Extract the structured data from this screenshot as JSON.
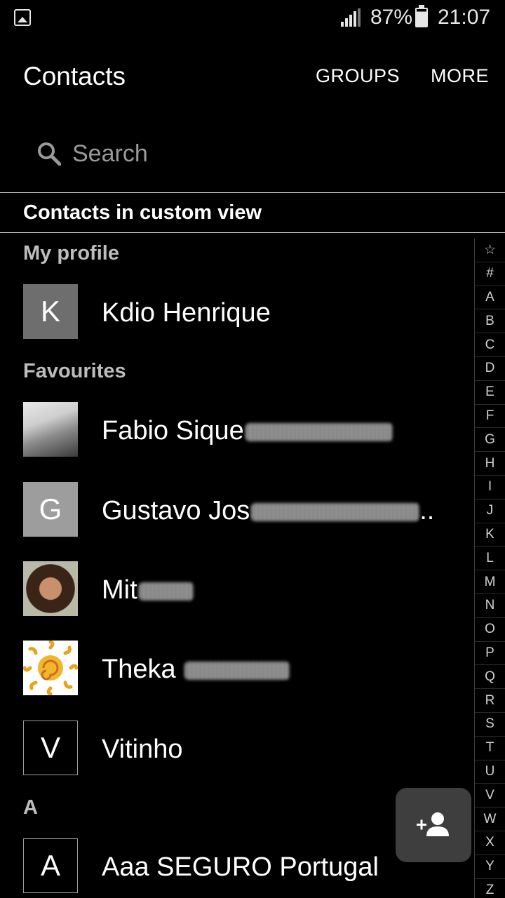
{
  "status_bar": {
    "battery_percent": "87%",
    "time": "21:07",
    "icons": [
      "image-notification-icon",
      "signal-icon",
      "battery-icon"
    ]
  },
  "app_bar": {
    "title": "Contacts",
    "actions": [
      "GROUPS",
      "MORE"
    ]
  },
  "search": {
    "placeholder": "Search"
  },
  "filter_label": "Contacts in custom view",
  "sections": {
    "my_profile": "My profile",
    "favourites": "Favourites",
    "a": "A"
  },
  "contacts": {
    "profile": {
      "initial": "K",
      "name": "Kdio Henrique"
    },
    "fav1": {
      "name": "Fabio Sique"
    },
    "fav2": {
      "initial": "G",
      "name": "Gustavo Jos",
      "ellipsis": ".."
    },
    "fav3": {
      "name": "Mit"
    },
    "fav4": {
      "name": "Theka"
    },
    "fav5": {
      "initial": "V",
      "name": "Vitinho"
    },
    "a1": {
      "initial": "A",
      "name": "Aaa SEGURO Portugal"
    }
  },
  "index_letters": [
    "☆",
    "#",
    "A",
    "B",
    "C",
    "D",
    "E",
    "F",
    "G",
    "H",
    "I",
    "J",
    "K",
    "L",
    "M",
    "N",
    "O",
    "P",
    "Q",
    "R",
    "S",
    "T",
    "U",
    "V",
    "W",
    "X",
    "Y",
    "Z"
  ],
  "colors": {
    "background": "#000000",
    "text": "#ffffff",
    "section": "#bdbdbd",
    "fab": "#3e3e3e"
  }
}
